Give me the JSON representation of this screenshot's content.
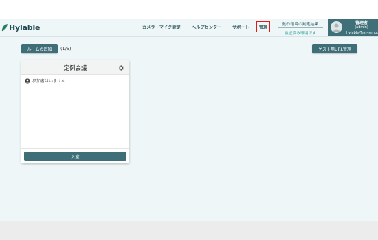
{
  "header": {
    "logo_text": "Hylable",
    "nav": {
      "camera_mic": "カメラ・マイク設定",
      "help_center": "ヘルプセンター",
      "support": "サポート",
      "admin": "管理"
    },
    "environment": {
      "title": "動作環境の判定結果",
      "status": "検証済み環境です"
    },
    "user": {
      "name": "管理者",
      "role": "(admin)",
      "id": "hylable-Test-remot"
    }
  },
  "toolbar": {
    "add_room_label": "ルームの追加",
    "room_count": "(1/5)",
    "guest_url_label": "ゲスト用URL管理"
  },
  "rooms": [
    {
      "title": "定例会議",
      "participants_text": "参加者はいません",
      "enter_label": "入室"
    }
  ],
  "colors": {
    "accent": "#3e6e77",
    "status_ok": "#2aa39a",
    "highlight_border": "#e01919"
  }
}
